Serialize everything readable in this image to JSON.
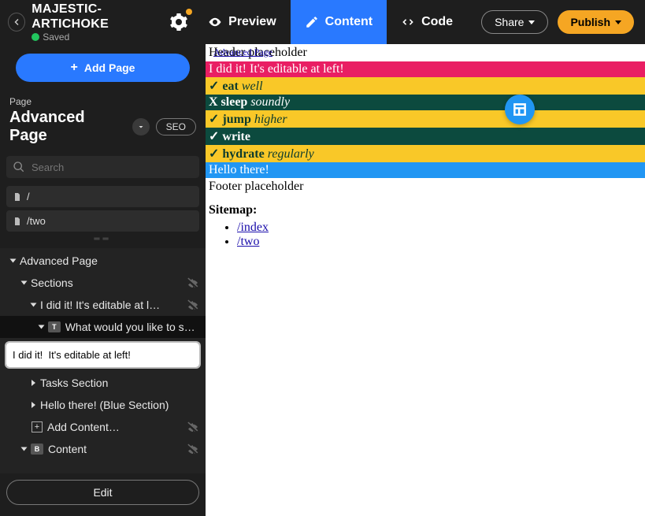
{
  "project": {
    "title": "MAJESTIC-ARTICHOKE",
    "saved_label": "Saved"
  },
  "topbar": {
    "tabs": {
      "preview": "Preview",
      "content": "Content",
      "code": "Code"
    },
    "share": "Share",
    "publish": "Publish"
  },
  "sidebar": {
    "add_page": "Add Page",
    "page_label": "Page",
    "page_name": "Advanced Page",
    "seo": "SEO",
    "search_placeholder": "Search",
    "routes": [
      "/",
      "/two"
    ],
    "input_value": "I did it!  It's editable at left!",
    "tree": {
      "root": "Advanced Page",
      "sections": "Sections",
      "intro_section": "I did it! It's editable at l…",
      "intro_field": "What would you like to say?",
      "tasks": "Tasks Section",
      "hello": "Hello there! (Blue Section)",
      "add_content": "Add Content…",
      "content": "Content"
    },
    "edit": "Edit"
  },
  "canvas": {
    "breadcrumb": "Advanced Page",
    "header": "Header placeholder",
    "intro": "I did it! It's editable at left!",
    "tasks": [
      {
        "mark": "✓",
        "verb": "eat",
        "rest": "well"
      },
      {
        "mark": "X",
        "verb": "sleep",
        "rest": "soundly"
      },
      {
        "mark": "✓",
        "verb": "jump",
        "rest": "higher"
      },
      {
        "mark": "✓",
        "verb": "write",
        "rest": ""
      },
      {
        "mark": "✓",
        "verb": "hydrate",
        "rest": "regularly"
      }
    ],
    "hello": "Hello there!",
    "footer": "Footer placeholder",
    "sitemap_label": "Sitemap:",
    "sitemap": [
      "/index",
      "/two"
    ]
  }
}
